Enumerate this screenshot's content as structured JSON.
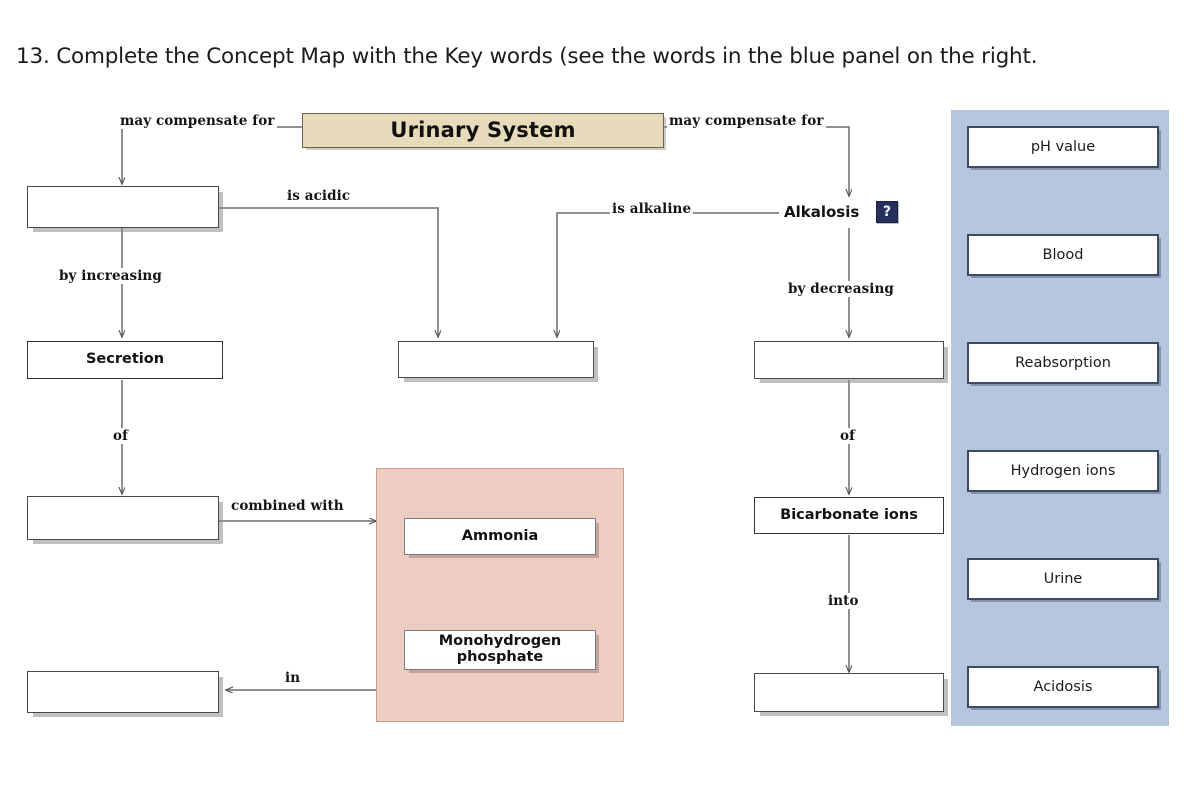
{
  "question": {
    "number": "13.",
    "text": "13. Complete the Concept Map with the Key words (see the words in the blue panel on the right."
  },
  "concept_map": {
    "title_node": {
      "label": "Urinary System"
    },
    "nodes": [
      {
        "id": "blank_left_top",
        "label": ""
      },
      {
        "id": "secretion",
        "label": "Secretion"
      },
      {
        "id": "blank_left_mid",
        "label": ""
      },
      {
        "id": "blank_left_bot",
        "label": ""
      },
      {
        "id": "blank_center",
        "label": ""
      },
      {
        "id": "alkalosis",
        "label": "Alkalosis"
      },
      {
        "id": "blank_right_top",
        "label": ""
      },
      {
        "id": "bicarbonate",
        "label": "Bicarbonate ions"
      },
      {
        "id": "blank_right_bot",
        "label": ""
      },
      {
        "id": "ammonia",
        "label": "Ammonia"
      },
      {
        "id": "monohydrogen",
        "label": "Monohydrogen\nphosphate"
      }
    ],
    "link_labels": {
      "may_compensate_left": "may compensate for",
      "may_compensate_right": "may compensate for",
      "is_acidic": "is acidic",
      "is_alkaline": "is alkaline",
      "by_increasing": "by increasing",
      "by_decreasing": "by decreasing",
      "of_left": "of",
      "of_right": "of",
      "combined_with": "combined with",
      "into": "into",
      "in": "in"
    },
    "badge": {
      "symbol": "?"
    },
    "colors": {
      "title_fill": "#e8dbbc",
      "group_fill": "#edcdc2",
      "key_panel_fill": "#b4c7dd",
      "key_item_border": "#3c4a63",
      "badge_fill": "#26305c"
    }
  },
  "key_panel": {
    "items": [
      {
        "label": "pH value"
      },
      {
        "label": "Blood"
      },
      {
        "label": "Reabsorption"
      },
      {
        "label": "Hydrogen ions"
      },
      {
        "label": "Urine"
      },
      {
        "label": "Acidosis"
      }
    ]
  }
}
